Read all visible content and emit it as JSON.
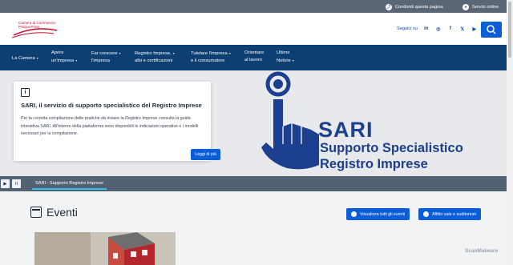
{
  "topbar": {
    "share_label": "Condividi questa pagina",
    "services_label": "Servizi online"
  },
  "header": {
    "logo_line1": "Camera di Commercio",
    "logo_line2": "Pistoia-Prato",
    "follow_label": "Seguici su",
    "socials": [
      "in",
      "◎",
      "f",
      "𝕏",
      "▶"
    ]
  },
  "nav": {
    "items": [
      {
        "line1": "La Camera",
        "line2": ""
      },
      {
        "line1": "Aprire",
        "line2": "un'impresa"
      },
      {
        "line1": "Far crescere",
        "line2": "l'impresa"
      },
      {
        "line1": "Registro Imprese,",
        "line2": "albi e certificazioni"
      },
      {
        "line1": "Tutelare l'impresa",
        "line2": "e il consumatore"
      },
      {
        "line1": "Orientare",
        "line2": "al lavoro"
      },
      {
        "line1": "Ultime",
        "line2": "Notizie"
      }
    ]
  },
  "hero": {
    "card_icon": "i",
    "card_title": "SARI, il servizio di supporto specialistico del Registro Imprese",
    "card_body": "Per la corretta compilazione delle pratiche da inviare la Registro Imprese consulta la guida interattiva SARI. All'interno della piattaforma sono disponibili le indicazioni operative e i modelli necessari per la compilazione.",
    "card_button": "Leggi di più",
    "sari_big": "SARI",
    "sari_line1": "Supporto Specialistico",
    "sari_line2": "Registro Imprese"
  },
  "carousel": {
    "play": "▶",
    "pause": "II",
    "tab_label": "SARI - Supporto Registro Imprese"
  },
  "events": {
    "title": "Eventi",
    "button_all": "Visualizza tutti gli eventi",
    "button_rooms": "Affitto sale e auditorium"
  },
  "watermark": "ScanMalware",
  "colors": {
    "primary": "#0b5ed7",
    "nav": "#0e3f73",
    "brand_red": "#c8102e",
    "sari_blue": "#1c3f8f"
  }
}
